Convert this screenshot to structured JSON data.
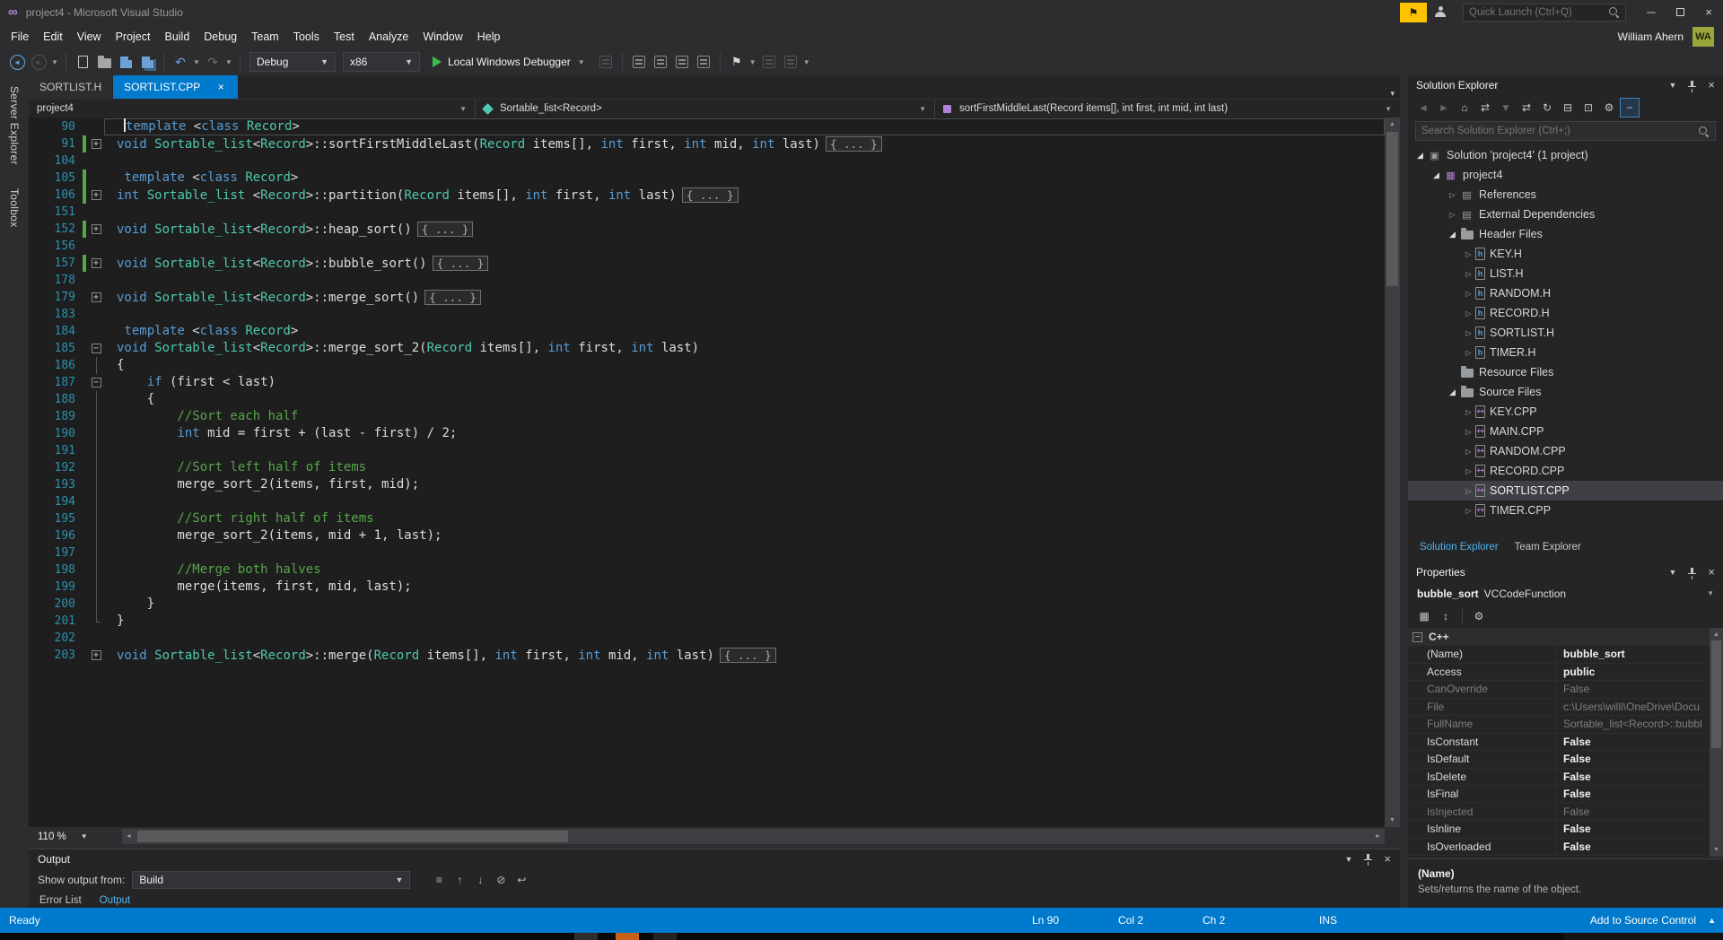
{
  "colors": {
    "accent": "#007ACC",
    "editor_bg": "#1E1E1E",
    "keyword": "#569CD6",
    "type": "#4EC9B0",
    "comment": "#57A64A",
    "line_number": "#2B91AF",
    "status_bar": "#007ACC",
    "active_tab": "#007ACC",
    "change_margin_green": "#57A64A"
  },
  "title_bar": {
    "title": "project4 - Microsoft Visual Studio",
    "quick_launch_placeholder": "Quick Launch (Ctrl+Q)"
  },
  "menu": [
    "File",
    "Edit",
    "View",
    "Project",
    "Build",
    "Debug",
    "Team",
    "Tools",
    "Test",
    "Analyze",
    "Window",
    "Help"
  ],
  "user": {
    "name": "William Ahern",
    "initials": "WA"
  },
  "toolbar": {
    "config": "Debug",
    "platform": "x86",
    "start": "Local Windows Debugger",
    "items": [
      {
        "t": "icon",
        "name": "navigate-backward-icon",
        "kind": "back"
      },
      {
        "t": "icon",
        "name": "navigate-forward-icon",
        "kind": "forward",
        "dim": true
      },
      {
        "t": "caret"
      },
      {
        "t": "sep"
      },
      {
        "t": "icon",
        "name": "new-file-icon",
        "kind": "doc"
      },
      {
        "t": "icon",
        "name": "open-file-icon",
        "kind": "folder"
      },
      {
        "t": "icon",
        "name": "save-icon",
        "kind": "floppy"
      },
      {
        "t": "icon",
        "name": "save-all-icon",
        "kind": "floppy-stack"
      },
      {
        "t": "sep"
      },
      {
        "t": "icon",
        "name": "undo-icon",
        "kind": "undo"
      },
      {
        "t": "caret"
      },
      {
        "t": "icon",
        "name": "redo-icon",
        "kind": "redo",
        "dim": true
      },
      {
        "t": "caret"
      },
      {
        "t": "sep"
      },
      {
        "t": "combo",
        "name": "solution-configurations-select",
        "bind": "config",
        "w": 96
      },
      {
        "t": "combo",
        "name": "solution-platforms-select",
        "bind": "platform",
        "w": 86
      },
      {
        "t": "start"
      },
      {
        "t": "icon",
        "name": "attach-to-process-icon",
        "kind": "generic",
        "dim": true
      },
      {
        "t": "sep"
      },
      {
        "t": "icon",
        "name": "display-member-list-icon",
        "kind": "generic"
      },
      {
        "t": "icon",
        "name": "display-parameter-info-icon",
        "kind": "generic"
      },
      {
        "t": "icon",
        "name": "display-quick-info-icon",
        "kind": "generic"
      },
      {
        "t": "icon",
        "name": "display-word-completion-icon",
        "kind": "generic"
      },
      {
        "t": "sep"
      },
      {
        "t": "icon",
        "name": "toggle-bookmark-icon",
        "kind": "flag"
      },
      {
        "t": "caret"
      },
      {
        "t": "icon",
        "name": "previous-bookmark-icon",
        "kind": "generic",
        "dim": true
      },
      {
        "t": "icon",
        "name": "next-bookmark-icon",
        "kind": "generic",
        "dim": true
      },
      {
        "t": "caret"
      }
    ]
  },
  "side_strip": [
    "Server Explorer",
    "Toolbox"
  ],
  "tabs": [
    {
      "label": "SORTLIST.H",
      "active": false
    },
    {
      "label": "SORTLIST.CPP",
      "active": true
    }
  ],
  "navbar": {
    "project": "project4",
    "type": "Sortable_list<Record>",
    "member": "sortFirstMiddleLast(Record items[], int first, int mid, int last)"
  },
  "editor": {
    "zoom": "110 %",
    "lines": [
      {
        "n": 90,
        "cur": true,
        "segs": [
          [
            "t",
            " "
          ],
          [
            "caret",
            ""
          ],
          [
            "k",
            "template"
          ],
          [
            "t",
            " <"
          ],
          [
            "k",
            "class"
          ],
          [
            "t",
            " "
          ],
          [
            "y",
            "Record"
          ],
          [
            "t",
            ">"
          ]
        ]
      },
      {
        "n": 91,
        "fold": "+",
        "green": true,
        "segs": [
          [
            "k",
            "void"
          ],
          [
            "t",
            " "
          ],
          [
            "y",
            "Sortable_list"
          ],
          [
            "t",
            "<"
          ],
          [
            "y",
            "Record"
          ],
          [
            "t",
            ">::sortFirstMiddleLast("
          ],
          [
            "y",
            "Record"
          ],
          [
            "t",
            " items[], "
          ],
          [
            "k",
            "int"
          ],
          [
            "t",
            " first, "
          ],
          [
            "k",
            "int"
          ],
          [
            "t",
            " mid, "
          ],
          [
            "k",
            "int"
          ],
          [
            "t",
            " last)"
          ],
          [
            "b",
            "{ ... }"
          ]
        ]
      },
      {
        "n": 104,
        "segs": []
      },
      {
        "n": 105,
        "green": true,
        "segs": [
          [
            "t",
            " "
          ],
          [
            "k",
            "template"
          ],
          [
            "t",
            " <"
          ],
          [
            "k",
            "class"
          ],
          [
            "t",
            " "
          ],
          [
            "y",
            "Record"
          ],
          [
            "t",
            ">"
          ]
        ]
      },
      {
        "n": 106,
        "fold": "+",
        "green": true,
        "segs": [
          [
            "k",
            "int"
          ],
          [
            "t",
            " "
          ],
          [
            "y",
            "Sortable_list"
          ],
          [
            "t",
            " <"
          ],
          [
            "y",
            "Record"
          ],
          [
            "t",
            ">::partition("
          ],
          [
            "y",
            "Record"
          ],
          [
            "t",
            " items[], "
          ],
          [
            "k",
            "int"
          ],
          [
            "t",
            " first, "
          ],
          [
            "k",
            "int"
          ],
          [
            "t",
            " last)"
          ],
          [
            "b",
            "{ ... }"
          ]
        ]
      },
      {
        "n": 151,
        "segs": []
      },
      {
        "n": 152,
        "fold": "+",
        "green": true,
        "segs": [
          [
            "k",
            "void"
          ],
          [
            "t",
            " "
          ],
          [
            "y",
            "Sortable_list"
          ],
          [
            "t",
            "<"
          ],
          [
            "y",
            "Record"
          ],
          [
            "t",
            ">::heap_sort()"
          ],
          [
            "b",
            "{ ... }"
          ]
        ]
      },
      {
        "n": 156,
        "segs": []
      },
      {
        "n": 157,
        "fold": "+",
        "green": true,
        "segs": [
          [
            "k",
            "void"
          ],
          [
            "t",
            " "
          ],
          [
            "y",
            "Sortable_list"
          ],
          [
            "t",
            "<"
          ],
          [
            "y",
            "Record"
          ],
          [
            "t",
            ">::bubble_sort()"
          ],
          [
            "b",
            "{ ... }"
          ]
        ]
      },
      {
        "n": 178,
        "segs": []
      },
      {
        "n": 179,
        "fold": "+",
        "segs": [
          [
            "k",
            "void"
          ],
          [
            "t",
            " "
          ],
          [
            "y",
            "Sortable_list"
          ],
          [
            "t",
            "<"
          ],
          [
            "y",
            "Record"
          ],
          [
            "t",
            ">::merge_sort()"
          ],
          [
            "b",
            "{ ... }"
          ]
        ]
      },
      {
        "n": 183,
        "segs": []
      },
      {
        "n": 184,
        "segs": [
          [
            "t",
            " "
          ],
          [
            "k",
            "template"
          ],
          [
            "t",
            " <"
          ],
          [
            "k",
            "class"
          ],
          [
            "t",
            " "
          ],
          [
            "y",
            "Record"
          ],
          [
            "t",
            ">"
          ]
        ]
      },
      {
        "n": 185,
        "fold": "-",
        "segs": [
          [
            "k",
            "void"
          ],
          [
            "t",
            " "
          ],
          [
            "y",
            "Sortable_list"
          ],
          [
            "t",
            "<"
          ],
          [
            "y",
            "Record"
          ],
          [
            "t",
            ">::merge_sort_2("
          ],
          [
            "y",
            "Record"
          ],
          [
            "t",
            " items[], "
          ],
          [
            "k",
            "int"
          ],
          [
            "t",
            " first, "
          ],
          [
            "k",
            "int"
          ],
          [
            "t",
            " last)"
          ]
        ]
      },
      {
        "n": 186,
        "fold": "|",
        "segs": [
          [
            "t",
            "{"
          ]
        ]
      },
      {
        "n": 187,
        "fold": "-",
        "segs": [
          [
            "t",
            "    "
          ],
          [
            "k",
            "if"
          ],
          [
            "t",
            " (first < last)"
          ]
        ]
      },
      {
        "n": 188,
        "fold": "|",
        "segs": [
          [
            "t",
            "    {"
          ]
        ]
      },
      {
        "n": 189,
        "fold": "|",
        "segs": [
          [
            "c",
            "        //Sort each half"
          ]
        ]
      },
      {
        "n": 190,
        "fold": "|",
        "segs": [
          [
            "t",
            "        "
          ],
          [
            "k",
            "int"
          ],
          [
            "t",
            " mid = first + (last - first) / 2;"
          ]
        ]
      },
      {
        "n": 191,
        "fold": "|",
        "segs": []
      },
      {
        "n": 192,
        "fold": "|",
        "segs": [
          [
            "c",
            "        //Sort left half of items"
          ]
        ]
      },
      {
        "n": 193,
        "fold": "|",
        "segs": [
          [
            "t",
            "        merge_sort_2(items, first, mid);"
          ]
        ]
      },
      {
        "n": 194,
        "fold": "|",
        "segs": []
      },
      {
        "n": 195,
        "fold": "|",
        "segs": [
          [
            "c",
            "        //Sort right half of items"
          ]
        ]
      },
      {
        "n": 196,
        "fold": "|",
        "segs": [
          [
            "t",
            "        merge_sort_2(items, mid + 1, last);"
          ]
        ]
      },
      {
        "n": 197,
        "fold": "|",
        "segs": []
      },
      {
        "n": 198,
        "fold": "|",
        "segs": [
          [
            "c",
            "        //Merge both halves"
          ]
        ]
      },
      {
        "n": 199,
        "fold": "|",
        "segs": [
          [
            "t",
            "        merge(items, first, mid, last);"
          ]
        ]
      },
      {
        "n": 200,
        "fold": "|",
        "segs": [
          [
            "t",
            "    }"
          ]
        ]
      },
      {
        "n": 201,
        "fold": "L",
        "segs": [
          [
            "t",
            "}"
          ]
        ]
      },
      {
        "n": 202,
        "segs": []
      },
      {
        "n": 203,
        "fold": "+",
        "segs": [
          [
            "k",
            "void"
          ],
          [
            "t",
            " "
          ],
          [
            "y",
            "Sortable_list"
          ],
          [
            "t",
            "<"
          ],
          [
            "y",
            "Record"
          ],
          [
            "t",
            ">::merge("
          ],
          [
            "y",
            "Record"
          ],
          [
            "t",
            " items[], "
          ],
          [
            "k",
            "int"
          ],
          [
            "t",
            " first, "
          ],
          [
            "k",
            "int"
          ],
          [
            "t",
            " mid, "
          ],
          [
            "k",
            "int"
          ],
          [
            "t",
            " last)"
          ],
          [
            "b",
            "{ ... }"
          ]
        ]
      }
    ]
  },
  "output": {
    "title": "Output",
    "show_from_label": "Show output from:",
    "source": "Build",
    "icons": [
      {
        "name": "find-message-icon",
        "glyph": "≡"
      },
      {
        "name": "go-to-previous-message-icon",
        "glyph": "↑"
      },
      {
        "name": "go-to-next-message-icon",
        "glyph": "↓"
      },
      {
        "name": "clear-all-icon",
        "glyph": "⊘"
      },
      {
        "name": "toggle-word-wrap-icon",
        "glyph": "↩"
      }
    ],
    "tabs": [
      "Error List",
      "Output"
    ],
    "active_tab": "Output"
  },
  "status_bar": {
    "state": "Ready",
    "line": "Ln 90",
    "col": "Col 2",
    "ch": "Ch 2",
    "mode": "INS",
    "source_control": "Add to Source Control"
  },
  "solution_explorer": {
    "title": "Solution Explorer",
    "search_placeholder": "Search Solution Explorer (Ctrl+;)",
    "toolbar_icons": [
      {
        "name": "back-icon",
        "glyph": "◄",
        "dim": true
      },
      {
        "name": "forward-icon",
        "glyph": "►",
        "dim": true
      },
      {
        "name": "home-icon",
        "glyph": "⌂"
      },
      {
        "name": "switch-views-icon",
        "glyph": "⇄"
      },
      {
        "name": "pending-changes-filter-icon",
        "glyph": "▼",
        "dim": true
      },
      {
        "name": "sync-with-active-document-icon",
        "glyph": "⇄"
      },
      {
        "name": "refresh-icon",
        "glyph": "↻"
      },
      {
        "name": "collapse-all-icon",
        "glyph": "⊟"
      },
      {
        "name": "show-all-files-icon",
        "glyph": "⊡"
      },
      {
        "name": "properties-icon",
        "glyph": "⚙"
      },
      {
        "name": "preview-selected-items-icon",
        "glyph": "−",
        "active": true
      }
    ],
    "tree": [
      {
        "level": 0,
        "expand": "open",
        "icon": "solution",
        "label": "Solution 'project4' (1 project)"
      },
      {
        "level": 1,
        "expand": "open",
        "icon": "project",
        "label": "project4"
      },
      {
        "level": 2,
        "expand": "closed",
        "icon": "references",
        "label": "References"
      },
      {
        "level": 2,
        "expand": "closed",
        "icon": "dependencies",
        "label": "External Dependencies"
      },
      {
        "level": 2,
        "expand": "open",
        "icon": "folder",
        "label": "Header Files"
      },
      {
        "level": 3,
        "expand": "closed",
        "icon": "header",
        "label": "KEY.H"
      },
      {
        "level": 3,
        "expand": "closed",
        "icon": "header",
        "label": "LIST.H"
      },
      {
        "level": 3,
        "expand": "closed",
        "icon": "header",
        "label": "RANDOM.H"
      },
      {
        "level": 3,
        "expand": "closed",
        "icon": "header",
        "label": "RECORD.H"
      },
      {
        "level": 3,
        "expand": "closed",
        "icon": "header",
        "label": "SORTLIST.H"
      },
      {
        "level": 3,
        "expand": "closed",
        "icon": "header",
        "label": "TIMER.H"
      },
      {
        "level": 2,
        "expand": "none",
        "icon": "folder",
        "label": "Resource Files"
      },
      {
        "level": 2,
        "expand": "open",
        "icon": "folder",
        "label": "Source Files"
      },
      {
        "level": 3,
        "expand": "closed",
        "icon": "cpp",
        "label": "KEY.CPP"
      },
      {
        "level": 3,
        "expand": "closed",
        "icon": "cpp",
        "label": "MAIN.CPP"
      },
      {
        "level": 3,
        "expand": "closed",
        "icon": "cpp",
        "label": "RANDOM.CPP"
      },
      {
        "level": 3,
        "expand": "closed",
        "icon": "cpp",
        "label": "RECORD.CPP"
      },
      {
        "level": 3,
        "expand": "closed",
        "icon": "cpp",
        "label": "SORTLIST.CPP",
        "selected": true
      },
      {
        "level": 3,
        "expand": "closed",
        "icon": "cpp",
        "label": "TIMER.CPP"
      }
    ],
    "tabs": [
      "Solution Explorer",
      "Team Explorer"
    ],
    "active_tab": "Solution Explorer"
  },
  "properties": {
    "title": "Properties",
    "object_name": "bubble_sort",
    "object_type": "VCCodeFunction",
    "toolbar_icons": [
      {
        "name": "categorized-icon",
        "glyph": "▦"
      },
      {
        "name": "alphabetical-icon",
        "glyph": "↕"
      },
      {
        "name": "property-pages-icon",
        "glyph": "⚙",
        "dim": true
      }
    ],
    "category": "C++",
    "rows": [
      {
        "name": "(Name)",
        "value": "bubble_sort",
        "dim": false
      },
      {
        "name": "Access",
        "value": "public",
        "dim": false
      },
      {
        "name": "CanOverride",
        "value": "False",
        "dim": true
      },
      {
        "name": "File",
        "value": "c:\\Users\\willi\\OneDrive\\Docu",
        "dim": true
      },
      {
        "name": "FullName",
        "value": "Sortable_list<Record>::bubbl",
        "dim": true
      },
      {
        "name": "IsConstant",
        "value": "False",
        "dim": false
      },
      {
        "name": "IsDefault",
        "value": "False",
        "dim": false
      },
      {
        "name": "IsDelete",
        "value": "False",
        "dim": false
      },
      {
        "name": "IsFinal",
        "value": "False",
        "dim": false
      },
      {
        "name": "IsInjected",
        "value": "False",
        "dim": true
      },
      {
        "name": "IsInline",
        "value": "False",
        "dim": false
      },
      {
        "name": "IsOverloaded",
        "value": "False",
        "dim": false
      }
    ],
    "description_title": "(Name)",
    "description_text": "Sets/returns the name of the object."
  }
}
